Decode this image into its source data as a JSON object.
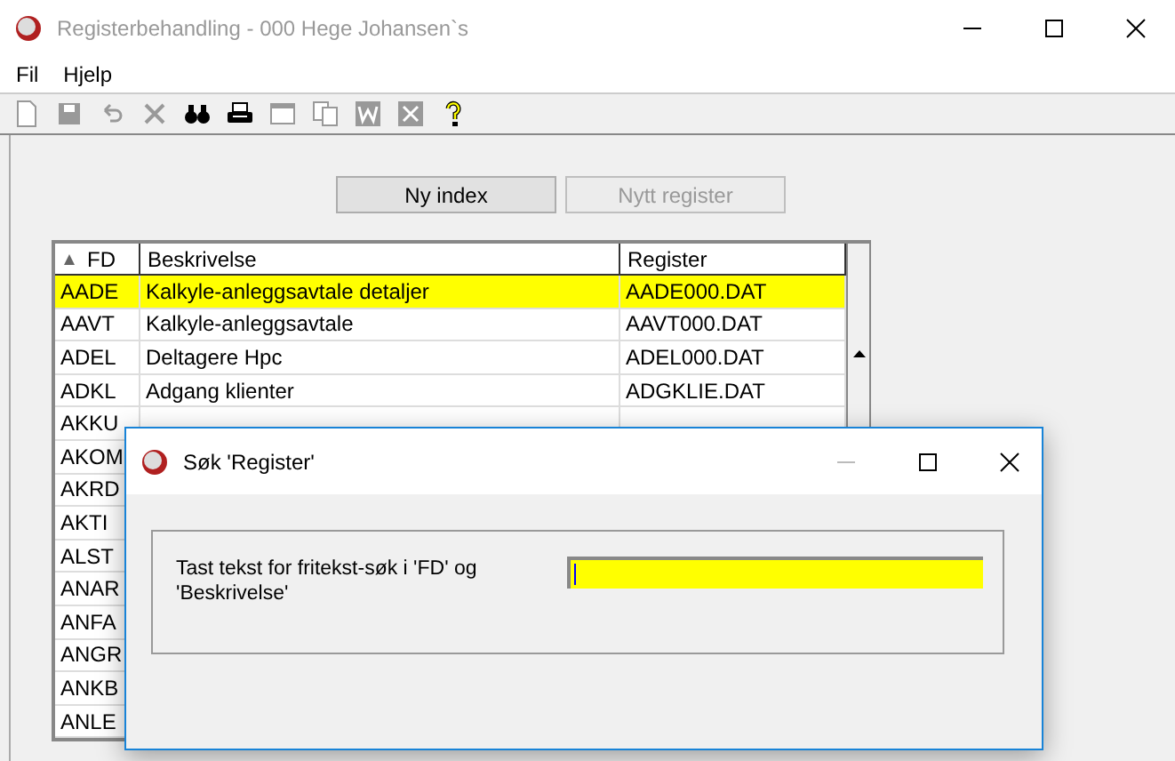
{
  "window": {
    "title": "Registerbehandling - 000 Hege Johansen`s"
  },
  "menu": [
    "Fil",
    "Hjelp"
  ],
  "toolbar": [
    {
      "kind": "new",
      "disabled": true
    },
    {
      "kind": "save",
      "disabled": true
    },
    {
      "kind": "undo",
      "disabled": true
    },
    {
      "kind": "delete",
      "disabled": true
    },
    {
      "kind": "find",
      "disabled": false
    },
    {
      "kind": "print",
      "disabled": false
    },
    {
      "kind": "window",
      "disabled": true
    },
    {
      "kind": "copy",
      "disabled": true
    },
    {
      "kind": "word",
      "disabled": true
    },
    {
      "kind": "excel",
      "disabled": true
    },
    {
      "kind": "help",
      "disabled": false
    }
  ],
  "buttons": [
    {
      "label": "Ny index",
      "disabled": false
    },
    {
      "label": "Nytt register",
      "disabled": true
    }
  ],
  "table": {
    "columns": [
      "FD",
      "Beskrivelse",
      "Register"
    ],
    "rows": [
      {
        "fd": "AADE",
        "description": "Kalkyle-anleggsavtale detaljer",
        "register": "AADE000.DAT",
        "selected": true
      },
      {
        "fd": "AAVT",
        "description": "Kalkyle-anleggsavtale",
        "register": "AAVT000.DAT",
        "selected": false
      },
      {
        "fd": "ADEL",
        "description": "Deltagere Hpc",
        "register": "ADEL000.DAT",
        "selected": false
      },
      {
        "fd": "ADKL",
        "description": "Adgang klienter",
        "register": "ADGKLIE.DAT",
        "selected": false
      },
      {
        "fd": "AKKU",
        "selected": false
      },
      {
        "fd": "AKOM",
        "selected": false
      },
      {
        "fd": "AKRD",
        "selected": false
      },
      {
        "fd": "AKTI",
        "selected": false
      },
      {
        "fd": "ALST",
        "selected": false
      },
      {
        "fd": "ANAR",
        "selected": false
      },
      {
        "fd": "ANFA",
        "selected": false
      },
      {
        "fd": "ANGR",
        "selected": false
      },
      {
        "fd": "ANKB",
        "selected": false
      },
      {
        "fd": "ANLE",
        "selected": false
      }
    ]
  },
  "dialog": {
    "title": "Søk 'Register'",
    "prompt": "Tast tekst for fritekst-søk i 'FD' og 'Beskrivelse'",
    "field": {
      "focused": true
    }
  }
}
